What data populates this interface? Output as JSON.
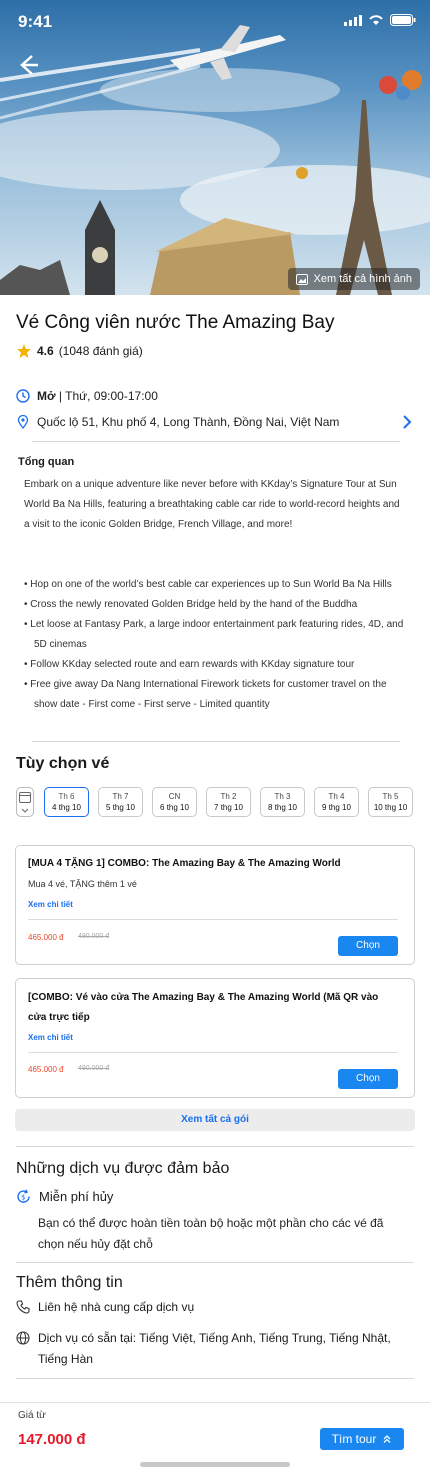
{
  "status_bar": {
    "time": "9:41"
  },
  "hero": {
    "see_all_photos": "Xem tất cả hình ảnh"
  },
  "title": "Vé Công viên nước The Amazing Bay",
  "rating": {
    "score": "4.6",
    "count": "(1048 đánh giá)"
  },
  "hours": {
    "status": "Mở",
    "text": "Thứ, 09:00-17:00"
  },
  "address": "Quốc lộ 51, Khu phố 4, Long Thành, Đồng Nai, Việt Nam",
  "overview": {
    "title": "Tổng quan",
    "text": "Embark on a unique adventure like never before with KKday’s Signature Tour at Sun World Ba Na Hills, featuring a breathtaking cable car ride to world-record heights and a visit to the iconic Golden Bridge, French Village, and more!",
    "bullets": [
      "Hop on one of the world’s best cable car experiences up to Sun World Ba Na Hills",
      "Cross the newly renovated Golden Bridge held by the hand of the Buddha",
      "Let loose at Fantasy Park, a large indoor entertainment park featuring rides, 4D, and 5D cinemas",
      "Follow KKday selected route and earn rewards with KKday signature tour",
      "Free give away Da Nang International Firework tickets for customer travel on the show date - First come - First serve - Limited quantity"
    ]
  },
  "ticket_options": {
    "title": "Tùy chọn vé",
    "dates": [
      {
        "day": "Th 6",
        "date": "4 thg 10"
      },
      {
        "day": "Th 7",
        "date": "5 thg 10"
      },
      {
        "day": "CN",
        "date": "6 thg 10"
      },
      {
        "day": "Th 2",
        "date": "7 thg 10"
      },
      {
        "day": "Th 3",
        "date": "8 thg 10"
      },
      {
        "day": "Th 4",
        "date": "9 thg 10"
      },
      {
        "day": "Th 5",
        "date": "10 thg 10"
      }
    ],
    "selected_date_index": 0,
    "packages": [
      {
        "title": "[MUA 4 TẶNG 1] COMBO: The Amazing Bay & The Amazing World",
        "subtitle": "Mua 4 vé, TẶNG thêm 1 vé",
        "details_link": "Xem chi tiết",
        "price": "465.000 đ",
        "old_price": "490.000 đ",
        "button": "Chọn"
      },
      {
        "title": "[COMBO: Vé vào cửa The Amazing Bay & The Amazing World (Mã QR vào cửa trực tiếp",
        "subtitle": "",
        "details_link": "Xem chi tiết",
        "price": "465.000 đ",
        "old_price": "490.000 đ",
        "button": "Chọn"
      }
    ],
    "see_all_packages": "Xem tất cả gói"
  },
  "guaranteed": {
    "title": "Những dịch vụ được đảm bảo",
    "item": "Miễn phí hủy",
    "desc": "Bạn có thể được hoàn tiền toàn bộ hoặc một phần cho các vé đã chọn nếu hủy đặt chỗ"
  },
  "more_info": {
    "title": "Thêm thông tin",
    "contact": "Liên hệ nhà cung cấp dịch vụ",
    "languages": "Dịch vụ có sẵn tại: Tiếng Việt, Tiếng Anh, Tiếng Trung, Tiếng Nhật, Tiếng Hàn"
  },
  "footer": {
    "from_label": "Giá từ",
    "price": "147.000 đ",
    "find_button": "Tìm tour"
  },
  "colors": {
    "accent": "#1a86f0",
    "price_red": "#e5192a",
    "star": "#f5b301"
  }
}
